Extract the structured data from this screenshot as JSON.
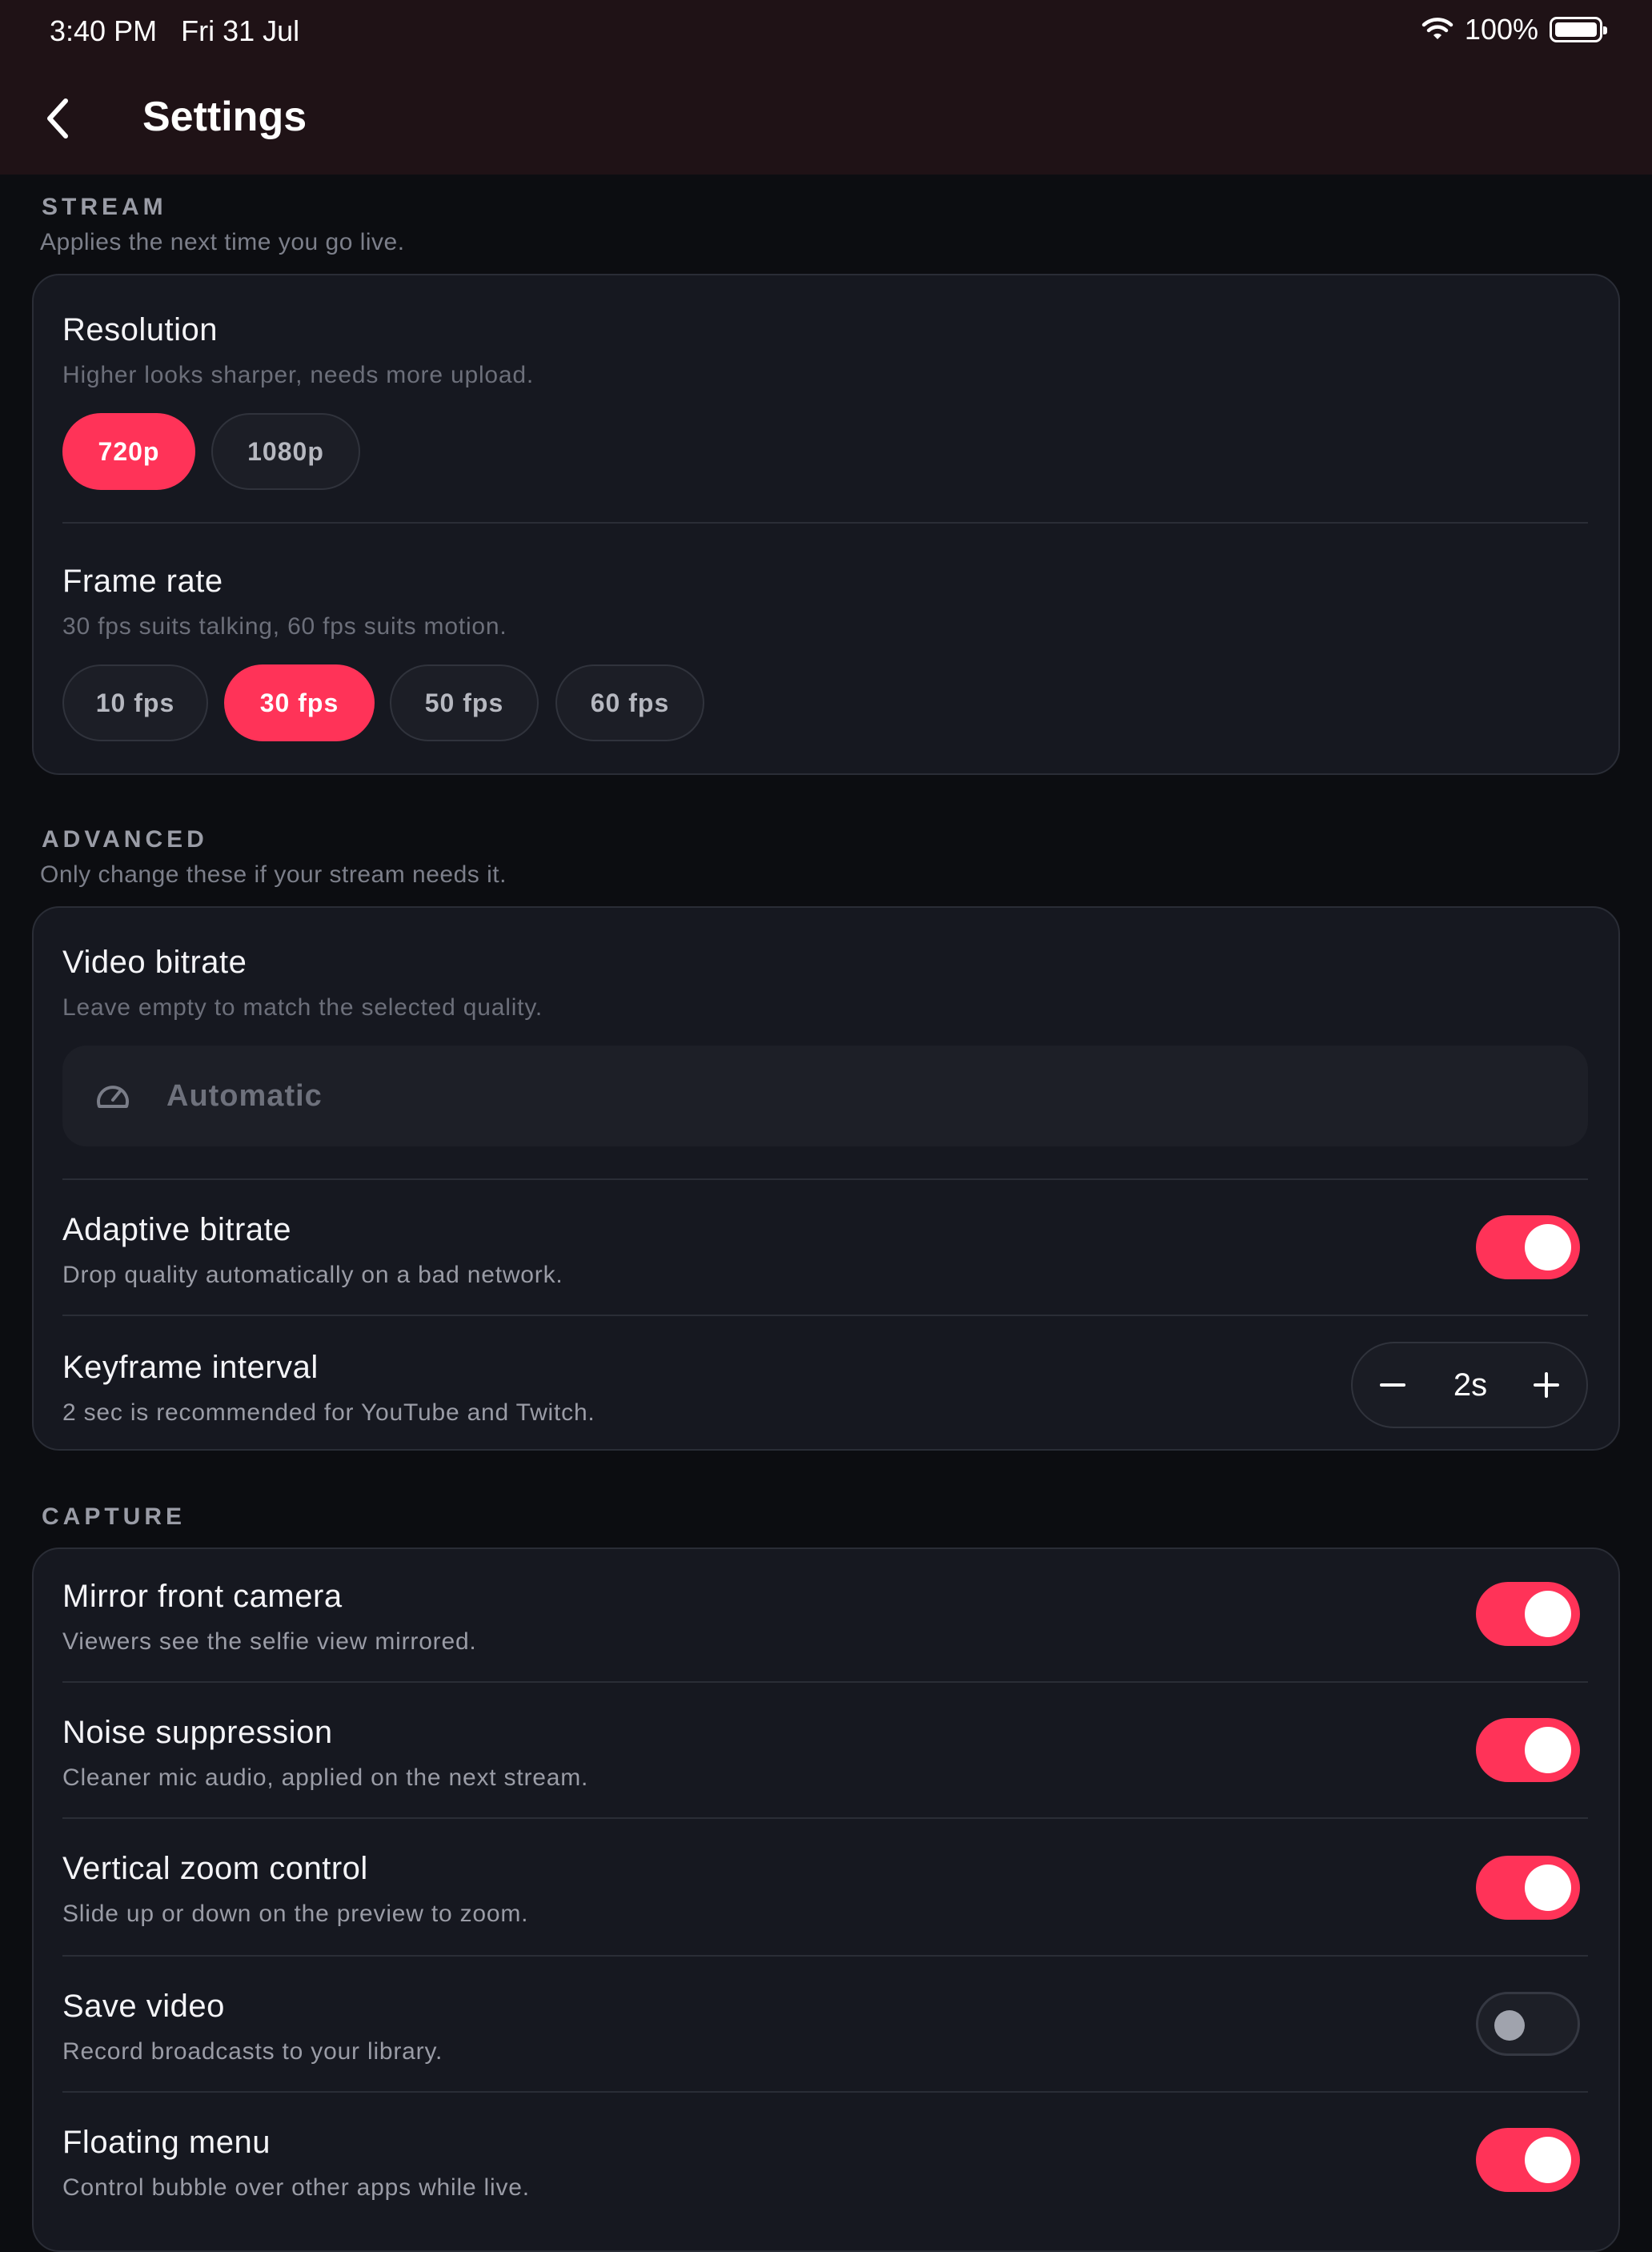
{
  "status_bar": {
    "time": "3:40 PM",
    "date": "Fri 31 Jul",
    "battery": "100%"
  },
  "app_bar": {
    "title": "Settings"
  },
  "stream": {
    "title": "STREAM",
    "subtitle": "Applies the next time you go live.",
    "resolution": {
      "label": "Resolution",
      "hint": "Higher looks sharper, needs more upload.",
      "options": [
        "720p",
        "1080p"
      ],
      "selected": "720p"
    },
    "frame_rate": {
      "label": "Frame rate",
      "hint": "30 fps suits talking, 60 fps suits motion.",
      "options": [
        "10 fps",
        "30 fps",
        "50 fps",
        "60 fps"
      ],
      "selected": "30 fps"
    }
  },
  "advanced": {
    "title": "ADVANCED",
    "subtitle": "Only change these if your stream needs it.",
    "video_bitrate": {
      "label": "Video bitrate",
      "hint": "Leave empty to match the selected quality.",
      "value": "",
      "placeholder": "Automatic",
      "icon": "speedometer-icon"
    },
    "adaptive_bitrate": {
      "label": "Adaptive bitrate",
      "hint": "Drop quality automatically on a bad network.",
      "enabled": true
    },
    "keyframe_interval": {
      "label": "Keyframe interval",
      "hint": "2 sec is recommended for YouTube and Twitch.",
      "value": "2s"
    }
  },
  "capture": {
    "title": "CAPTURE",
    "items": [
      {
        "label": "Mirror front camera",
        "hint": "Viewers see the selfie view mirrored.",
        "enabled": true
      },
      {
        "label": "Noise suppression",
        "hint": "Cleaner mic audio, applied on the next stream.",
        "enabled": true
      },
      {
        "label": "Vertical zoom control",
        "hint": "Slide up or down on the preview to zoom.",
        "enabled": true
      },
      {
        "label": "Save video",
        "hint": "Record broadcasts to your library.",
        "enabled": false
      },
      {
        "label": "Floating menu",
        "hint": "Control bubble over other apps while live.",
        "enabled": true
      }
    ]
  },
  "colors": {
    "accent": "#ff3358",
    "background": "#0c0d11",
    "card": "#161820",
    "header": "#1f1216"
  }
}
